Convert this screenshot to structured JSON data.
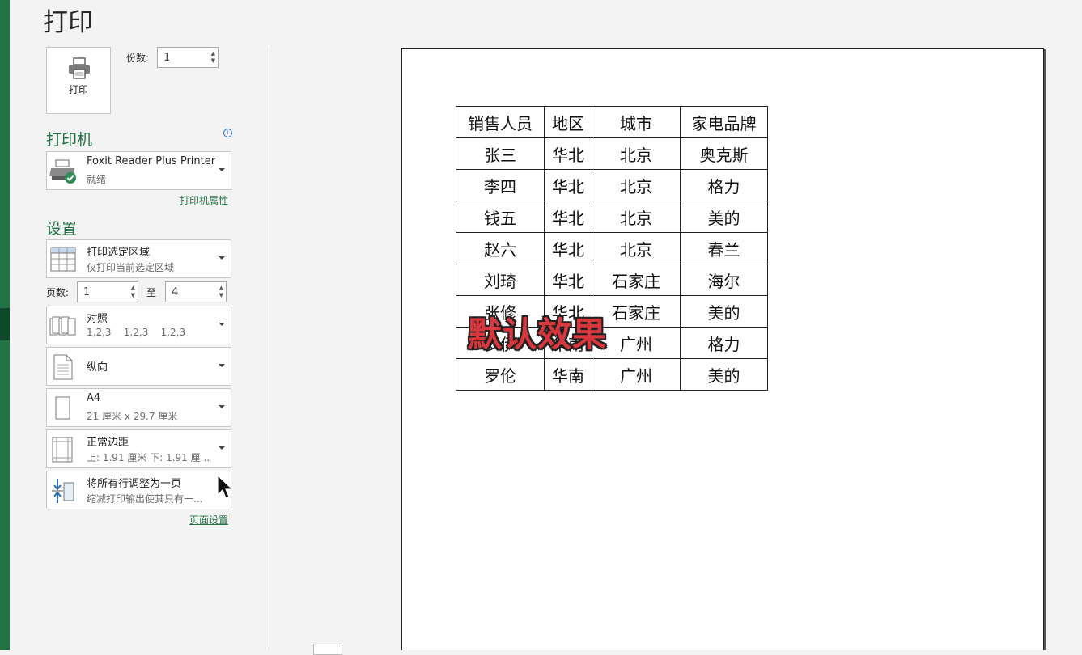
{
  "page_title": "打印",
  "print_button_label": "打印",
  "copies": {
    "label": "份数:",
    "value": "1"
  },
  "printer": {
    "section_title": "打印机",
    "name": "Foxit Reader Plus Printer",
    "status": "就绪",
    "properties_link": "打印机属性"
  },
  "settings": {
    "section_title": "设置",
    "scope": {
      "title": "打印选定区域",
      "subtitle": "仅打印当前选定区域"
    },
    "pages": {
      "label": "页数:",
      "from": "1",
      "to_label": "至",
      "to": "4"
    },
    "collate": {
      "title": "对照",
      "subtitle": "1,2,3    1,2,3    1,2,3"
    },
    "orientation": {
      "title": "纵向"
    },
    "paper_size": {
      "title": "A4",
      "subtitle": "21 厘米 x 29.7 厘米"
    },
    "margins": {
      "title": "正常边距",
      "subtitle": "上: 1.91 厘米 下: 1.91 厘..."
    },
    "scaling": {
      "title": "将所有行调整为一页",
      "subtitle": "缩减打印输出使其只有一..."
    },
    "page_setup_link": "页面设置"
  },
  "preview": {
    "overlay_text": "默认效果",
    "table": {
      "headers": [
        "销售人员",
        "地区",
        "城市",
        "家电品牌"
      ],
      "rows": [
        [
          "张三",
          "华北",
          "北京",
          "奥克斯"
        ],
        [
          "李四",
          "华北",
          "北京",
          "格力"
        ],
        [
          "钱五",
          "华北",
          "北京",
          "美的"
        ],
        [
          "赵六",
          "华北",
          "北京",
          "春兰"
        ],
        [
          "刘琦",
          "华北",
          "石家庄",
          "海尔"
        ],
        [
          "张修",
          "华北",
          "石家庄",
          "美的"
        ],
        [
          "罗伊",
          "华南",
          "广州",
          "格力"
        ],
        [
          "罗伦",
          "华南",
          "广州",
          "美的"
        ]
      ]
    }
  },
  "colors": {
    "accent": "#217346",
    "overlay": "#d9363e"
  }
}
